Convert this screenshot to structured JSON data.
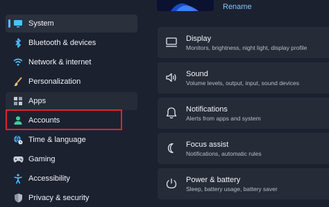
{
  "sidebar": {
    "items": [
      {
        "label": "System",
        "icon": "monitor-icon",
        "selected": true
      },
      {
        "label": "Bluetooth & devices",
        "icon": "bluetooth-icon"
      },
      {
        "label": "Network & internet",
        "icon": "wifi-icon"
      },
      {
        "label": "Personalization",
        "icon": "paintbrush-icon"
      },
      {
        "label": "Apps",
        "icon": "apps-icon"
      },
      {
        "label": "Accounts",
        "icon": "person-icon",
        "highlighted": true
      },
      {
        "label": "Time & language",
        "icon": "globe-clock-icon"
      },
      {
        "label": "Gaming",
        "icon": "gamepad-icon"
      },
      {
        "label": "Accessibility",
        "icon": "accessibility-icon"
      },
      {
        "label": "Privacy & security",
        "icon": "shield-icon"
      }
    ]
  },
  "device": {
    "rename_label": "Rename"
  },
  "settings": [
    {
      "title": "Display",
      "subtitle": "Monitors, brightness, night light, display profile",
      "icon": "display-icon"
    },
    {
      "title": "Sound",
      "subtitle": "Volume levels, output, input, sound devices",
      "icon": "speaker-icon"
    },
    {
      "title": "Notifications",
      "subtitle": "Alerts from apps and system",
      "icon": "bell-icon"
    },
    {
      "title": "Focus assist",
      "subtitle": "Notifications, automatic rules",
      "icon": "moon-icon"
    },
    {
      "title": "Power & battery",
      "subtitle": "Sleep, battery usage, battery saver",
      "icon": "power-icon"
    }
  ],
  "colors": {
    "accent": "#4cc2ff",
    "highlight_border": "#e0232e",
    "background": "#1c2130",
    "card": "#262b38"
  }
}
